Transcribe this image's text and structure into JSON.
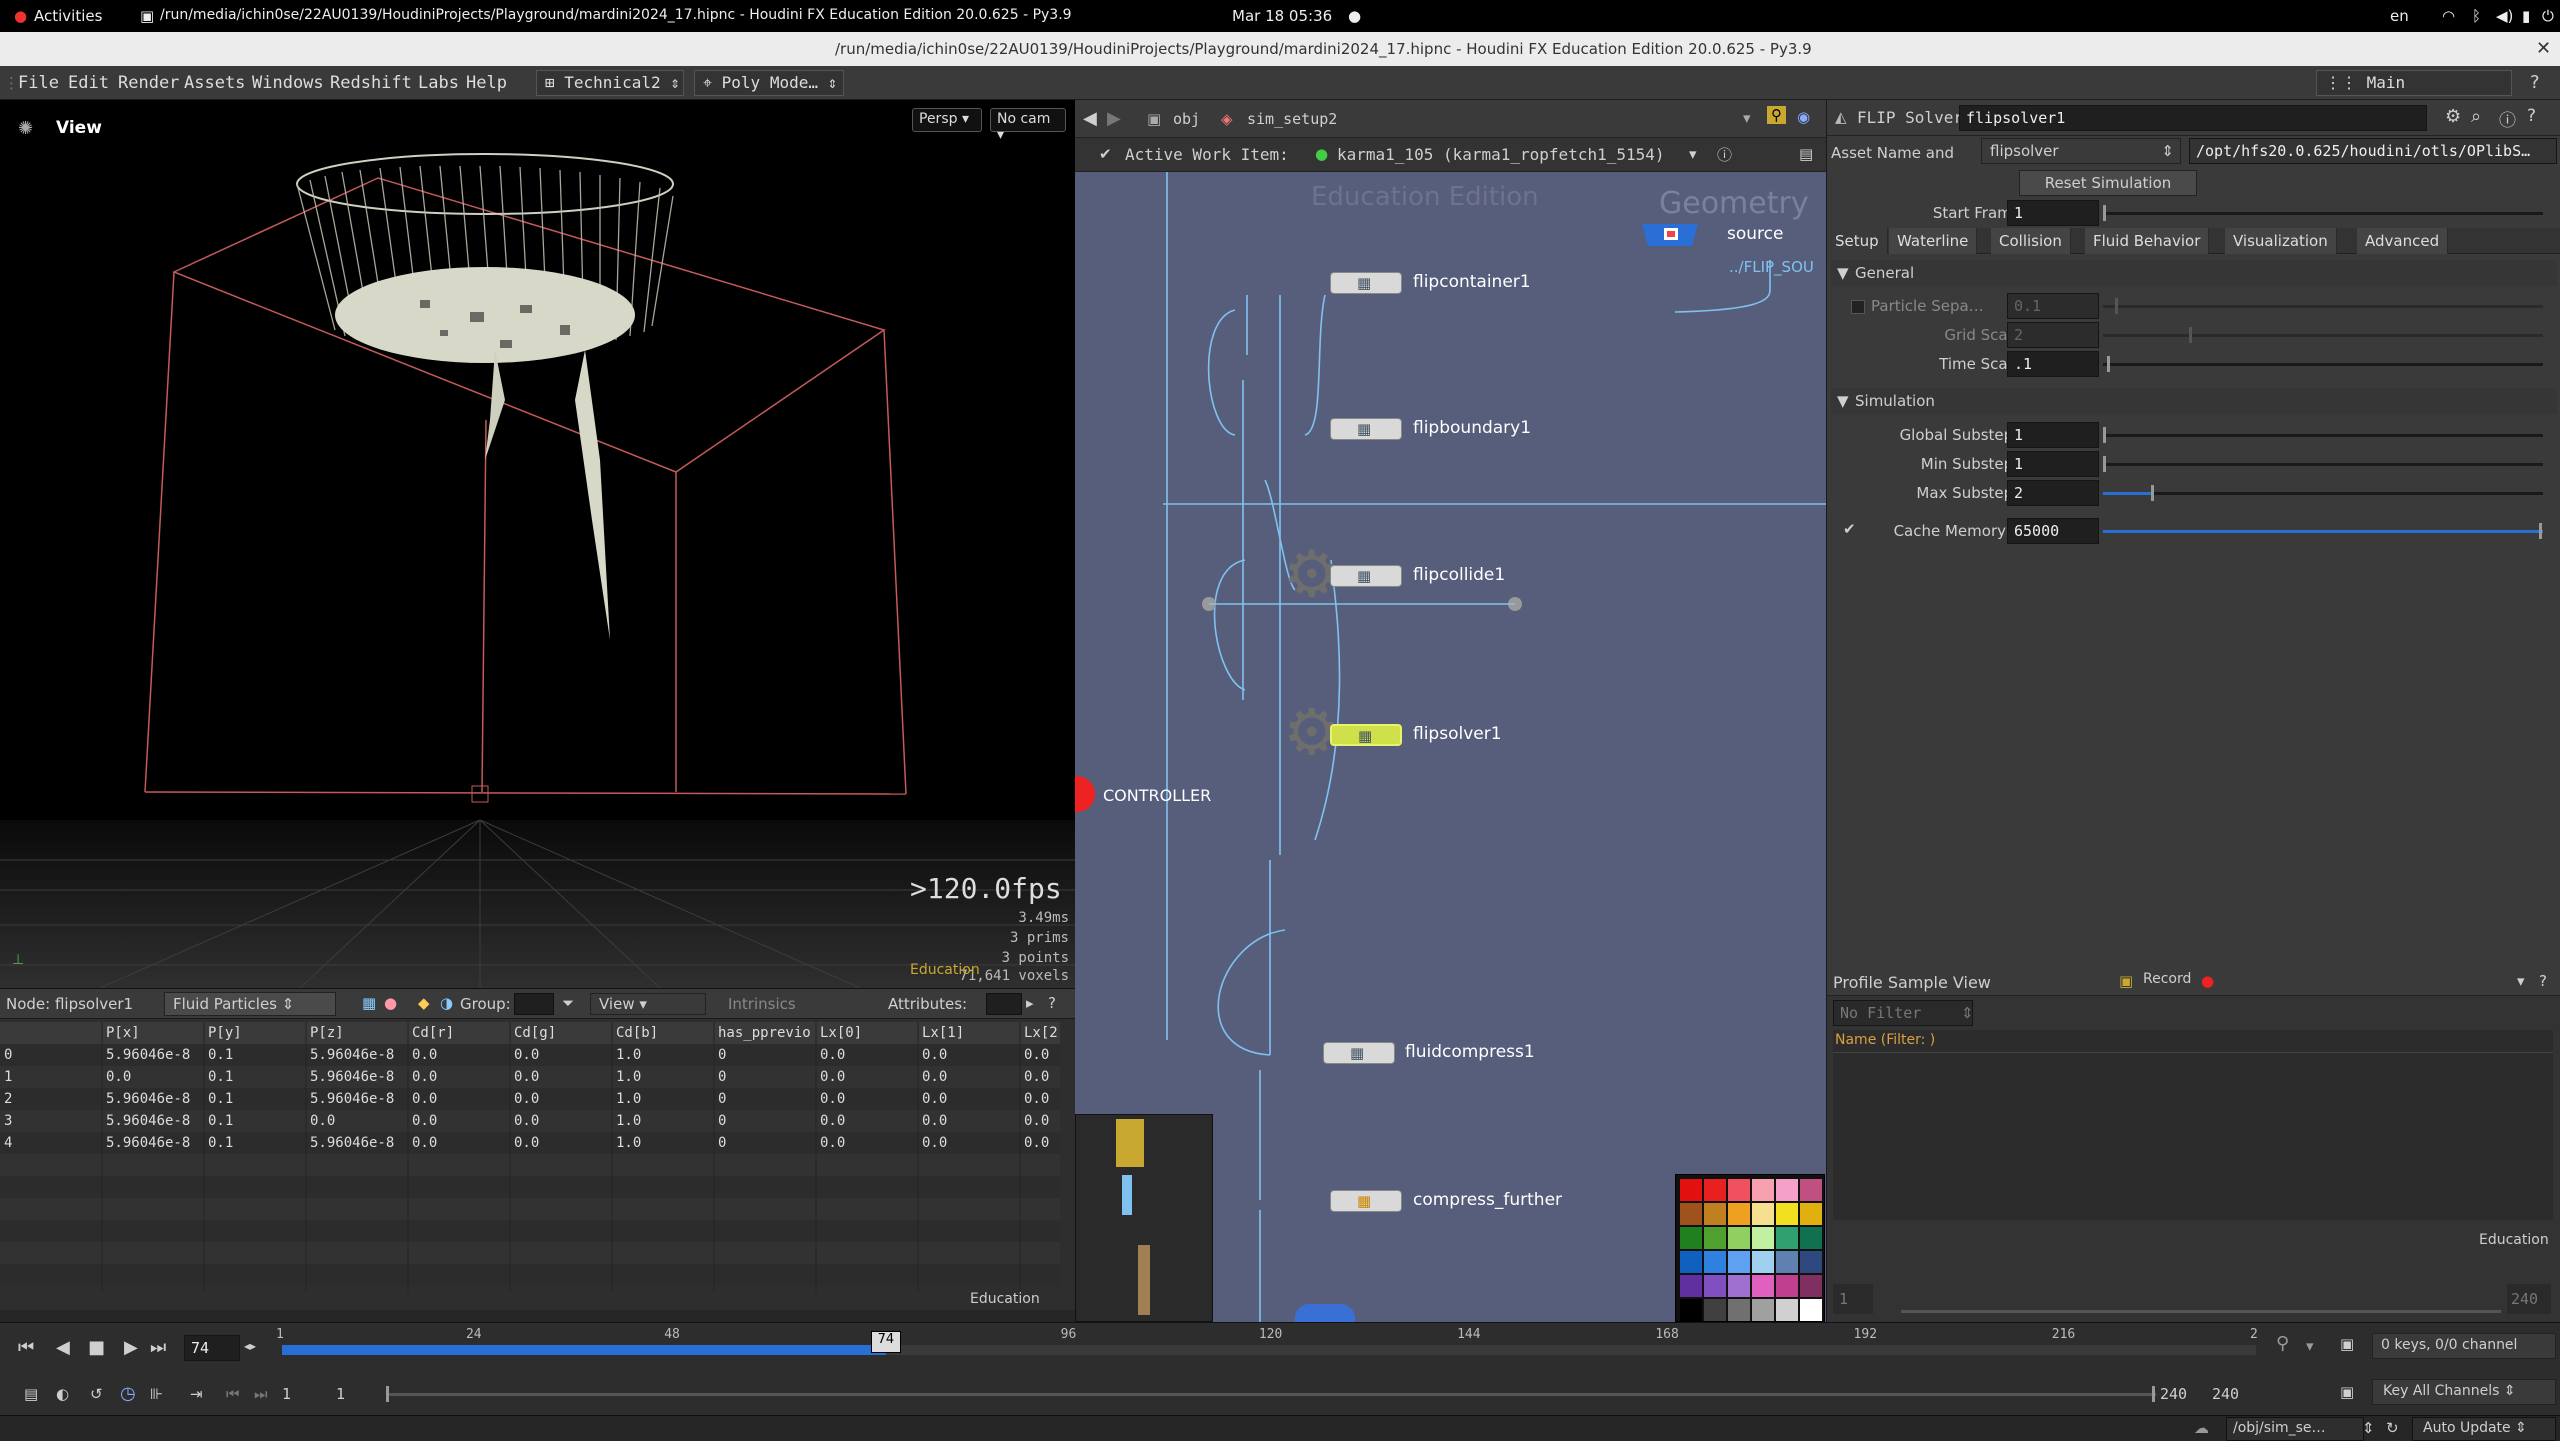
{
  "system_bar": {
    "activities": "Activities",
    "window_title": "/run/media/ichin0se/22AU0139/HoudiniProjects/Playground/mardini2024_17.hipnc - Houdini FX Education Edition 20.0.625 - Py3.9",
    "clock": "Mar 18  05:36",
    "language": "en"
  },
  "window": {
    "title": "/run/media/ichin0se/22AU0139/HoudiniProjects/Playground/mardini2024_17.hipnc - Houdini FX Education Edition 20.0.625 - Py3.9"
  },
  "menu": {
    "items": [
      "File",
      "Edit",
      "Render",
      "Assets",
      "Windows",
      "Redshift",
      "Labs",
      "Help"
    ],
    "desktop": "Technical2",
    "shelf": "Poly Mode…",
    "pane_set": "Main"
  },
  "viewport": {
    "title": "View",
    "camera_menu": "Persp",
    "cam_menu": "No cam",
    "fps": ">120.0fps",
    "stats": [
      "3.49ms",
      "3  prims",
      "3  points",
      "71,641 voxels"
    ],
    "watermark": "Education"
  },
  "spreadsheet": {
    "node_label": "Node: flipsolver1",
    "context": "Fluid Particles",
    "group_label": "Group:",
    "view_menu": "View",
    "intrinsics": "Intrinsics",
    "attributes_label": "Attributes:",
    "columns": [
      "",
      "P[x]",
      "P[y]",
      "P[z]",
      "Cd[r]",
      "Cd[g]",
      "Cd[b]",
      "has_pprevio",
      "Lx[0]",
      "Lx[1]",
      "Lx[2"
    ],
    "rows": [
      [
        "0",
        "5.96046e-8",
        "0.1",
        "5.96046e-8",
        "0.0",
        "0.0",
        "1.0",
        "0",
        "0.0",
        "0.0",
        "0.0"
      ],
      [
        "1",
        "0.0",
        "0.1",
        "5.96046e-8",
        "0.0",
        "0.0",
        "1.0",
        "0",
        "0.0",
        "0.0",
        "0.0"
      ],
      [
        "2",
        "5.96046e-8",
        "0.1",
        "5.96046e-8",
        "0.0",
        "0.0",
        "1.0",
        "0",
        "0.0",
        "0.0",
        "0.0"
      ],
      [
        "3",
        "5.96046e-8",
        "0.1",
        "0.0",
        "0.0",
        "0.0",
        "1.0",
        "0",
        "0.0",
        "0.0",
        "0.0"
      ],
      [
        "4",
        "5.96046e-8",
        "0.1",
        "5.96046e-8",
        "0.0",
        "0.0",
        "1.0",
        "0",
        "0.0",
        "0.0",
        "0.0"
      ]
    ],
    "watermark": "Education"
  },
  "network": {
    "path_obj": "obj",
    "path_sim": "sim_setup2",
    "work_item_label": "Active Work Item:",
    "work_item": "karma1_105 (karma1_ropfetch1_5154)",
    "edition_watermark": "Education Edition",
    "context_watermark": "Geometry",
    "flip_source_ref": "../FLIP_SOU",
    "nodes": {
      "source": "source",
      "flipcontainer": "flipcontainer1",
      "flipboundary": "flipboundary1",
      "flipcollide": "flipcollide1",
      "flipsolver": "flipsolver1",
      "controller": "CONTROLLER",
      "fluidcompress": "fluidcompress1",
      "compress_further": "compress_further"
    }
  },
  "params": {
    "node_type": "FLIP Solver",
    "node_name": "flipsolver1",
    "asset_label": "Asset Name and",
    "asset_name": "flipsolver",
    "asset_path": "/opt/hfs20.0.625/houdini/otls/OPlibS…",
    "reset_button": "Reset Simulation",
    "start_frame_label": "Start Frame",
    "start_frame": "1",
    "tabs": [
      "Setup",
      "Waterline",
      "Collision",
      "Fluid Behavior",
      "Visualization",
      "Advanced"
    ],
    "general_header": "General",
    "particle_sep_label": "Particle Sepa…",
    "particle_sep": "0.1",
    "grid_scale_label": "Grid Scale",
    "grid_scale": "2",
    "time_scale_label": "Time Scale",
    "time_scale": ".1",
    "simulation_header": "Simulation",
    "global_substeps_label": "Global Substeps",
    "global_substeps": "1",
    "min_substeps_label": "Min Substeps",
    "min_substeps": "1",
    "max_substeps_label": "Max Substeps",
    "max_substeps": "2",
    "cache_memory_label": "Cache Memory…",
    "cache_memory": "65000"
  },
  "profile": {
    "title": "Profile Sample View",
    "record": "Record",
    "filter_placeholder": "No Filter",
    "name_header": "Name  (Filter: )",
    "watermark": "Education",
    "frame_left": "1",
    "frame_right": "240"
  },
  "timeline": {
    "current_frame": "74",
    "playhead_label": "74",
    "ticks": [
      "1",
      "24",
      "48",
      "96",
      "120",
      "144",
      "168",
      "192",
      "216",
      "2"
    ],
    "start_frame": "1",
    "start_frame2": "1",
    "end_frame": "240",
    "end_frame2": "240",
    "keys_info": "0 keys, 0/0 channel",
    "key_all": "Key All Channels",
    "status_path": "/obj/sim_se…",
    "auto_update": "Auto Update",
    "playhead_fraction": 0.3059
  },
  "colors": {
    "network_bg": "#575e7c",
    "selected_node": "#cfe04a",
    "timeline_blue": "#2a6fd6"
  }
}
